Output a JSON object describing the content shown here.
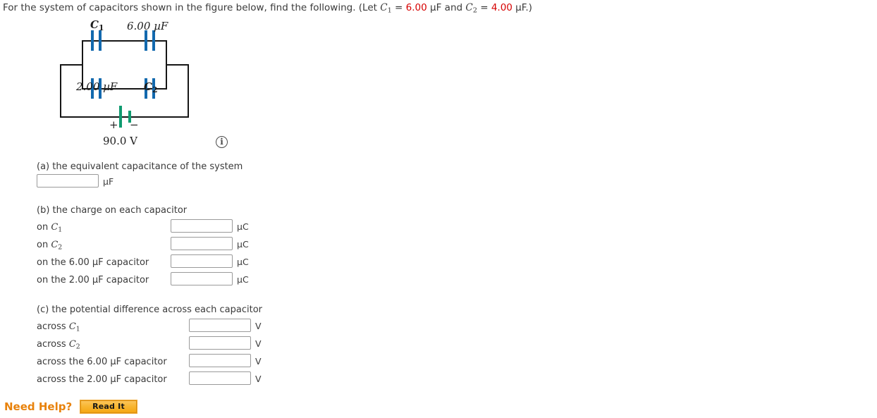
{
  "prompt": {
    "text_before": "For the system of capacitors shown in the figure below, find the following. (Let ",
    "c1_symbol": "C",
    "c1_sub": "1",
    "eq1": " = ",
    "c1_value": "6.00",
    "unit1": " µF and ",
    "c2_symbol": "C",
    "c2_sub": "2",
    "eq2": " = ",
    "c2_value": "4.00",
    "unit2": " µF.)",
    "value_color": "#d60000"
  },
  "figure": {
    "label_c1": "C",
    "label_c1_sub": "1",
    "label_top_right": "6.00 µF",
    "label_bottom_left": "2.00 µF",
    "label_c2": "C",
    "label_c2_sub": "2",
    "battery_plus": "+",
    "battery_minus": "−",
    "battery_voltage": "90.0 V",
    "info_icon_glyph": "i",
    "capacitor_plate_color": "#1269ae",
    "battery_plate_color": "#0f9b70",
    "wire_color": "#161616"
  },
  "part_a": {
    "heading": "(a) the equivalent capacitance of the system",
    "value": "",
    "placeholder": "",
    "unit": "µF"
  },
  "part_b": {
    "heading": "(b) the charge on each capacitor",
    "rows": [
      {
        "prefix": "on ",
        "symbol": "C",
        "sub": "1",
        "suffix": "",
        "value": "",
        "unit": "µC"
      },
      {
        "prefix": "on ",
        "symbol": "C",
        "sub": "2",
        "suffix": "",
        "value": "",
        "unit": "µC"
      },
      {
        "prefix": "on the 6.00 µF capacitor",
        "symbol": "",
        "sub": "",
        "suffix": "",
        "value": "",
        "unit": "µC"
      },
      {
        "prefix": "on the 2.00 µF capacitor",
        "symbol": "",
        "sub": "",
        "suffix": "",
        "value": "",
        "unit": "µC"
      }
    ]
  },
  "part_c": {
    "heading": "(c) the potential difference across each capacitor",
    "rows": [
      {
        "prefix": "across ",
        "symbol": "C",
        "sub": "1",
        "suffix": "",
        "value": "",
        "unit": "V"
      },
      {
        "prefix": "across ",
        "symbol": "C",
        "sub": "2",
        "suffix": "",
        "value": "",
        "unit": "V"
      },
      {
        "prefix": "across the 6.00 µF capacitor",
        "symbol": "",
        "sub": "",
        "suffix": "",
        "value": "",
        "unit": "V"
      },
      {
        "prefix": "across the 2.00 µF capacitor",
        "symbol": "",
        "sub": "",
        "suffix": "",
        "value": "",
        "unit": "V"
      }
    ]
  },
  "footer": {
    "need_help_label": "Need Help?",
    "read_it_label": "Read It",
    "need_help_color": "#e8820c"
  }
}
